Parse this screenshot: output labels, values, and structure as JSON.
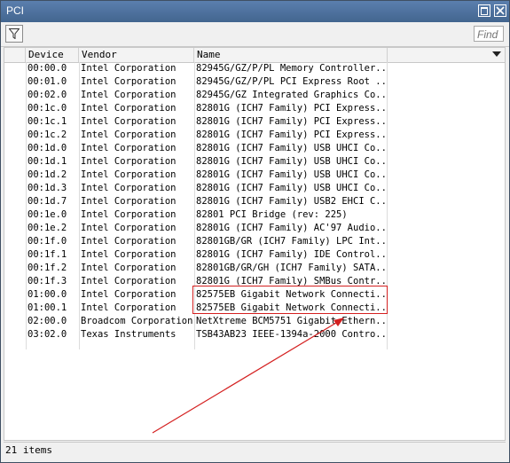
{
  "window": {
    "title": "PCI"
  },
  "toolbar": {
    "find_placeholder": "Find"
  },
  "table": {
    "columns": [
      "Device",
      "Vendor",
      "Name"
    ],
    "rows": [
      {
        "device": "00:00.0",
        "vendor": "Intel Corporation",
        "name": "82945G/GZ/P/PL Memory Controller..."
      },
      {
        "device": "00:01.0",
        "vendor": "Intel Corporation",
        "name": "82945G/GZ/P/PL PCI Express Root ..."
      },
      {
        "device": "00:02.0",
        "vendor": "Intel Corporation",
        "name": "82945G/GZ Integrated Graphics Co..."
      },
      {
        "device": "00:1c.0",
        "vendor": "Intel Corporation",
        "name": "82801G (ICH7 Family) PCI Express..."
      },
      {
        "device": "00:1c.1",
        "vendor": "Intel Corporation",
        "name": "82801G (ICH7 Family) PCI Express..."
      },
      {
        "device": "00:1c.2",
        "vendor": "Intel Corporation",
        "name": "82801G (ICH7 Family) PCI Express..."
      },
      {
        "device": "00:1d.0",
        "vendor": "Intel Corporation",
        "name": "82801G (ICH7 Family) USB UHCI Co..."
      },
      {
        "device": "00:1d.1",
        "vendor": "Intel Corporation",
        "name": "82801G (ICH7 Family) USB UHCI Co..."
      },
      {
        "device": "00:1d.2",
        "vendor": "Intel Corporation",
        "name": "82801G (ICH7 Family) USB UHCI Co..."
      },
      {
        "device": "00:1d.3",
        "vendor": "Intel Corporation",
        "name": "82801G (ICH7 Family) USB UHCI Co..."
      },
      {
        "device": "00:1d.7",
        "vendor": "Intel Corporation",
        "name": "82801G (ICH7 Family) USB2 EHCI C..."
      },
      {
        "device": "00:1e.0",
        "vendor": "Intel Corporation",
        "name": "82801 PCI Bridge (rev: 225)"
      },
      {
        "device": "00:1e.2",
        "vendor": "Intel Corporation",
        "name": "82801G (ICH7 Family) AC'97 Audio..."
      },
      {
        "device": "00:1f.0",
        "vendor": "Intel Corporation",
        "name": "82801GB/GR (ICH7 Family) LPC Int..."
      },
      {
        "device": "00:1f.1",
        "vendor": "Intel Corporation",
        "name": "82801G (ICH7 Family) IDE Control..."
      },
      {
        "device": "00:1f.2",
        "vendor": "Intel Corporation",
        "name": "82801GB/GR/GH (ICH7 Family) SATA..."
      },
      {
        "device": "00:1f.3",
        "vendor": "Intel Corporation",
        "name": "82801G (ICH7 Family) SMBus Contr..."
      },
      {
        "device": "01:00.0",
        "vendor": "Intel Corporation",
        "name": "82575EB Gigabit Network Connecti..."
      },
      {
        "device": "01:00.1",
        "vendor": "Intel Corporation",
        "name": "82575EB Gigabit Network Connecti..."
      },
      {
        "device": "02:00.0",
        "vendor": "Broadcom Corporation",
        "name": "NetXtreme BCM5751 Gigabit Ethern..."
      },
      {
        "device": "03:02.0",
        "vendor": "Texas Instruments",
        "name": "TSB43AB23 IEEE-1394a-2000 Contro..."
      }
    ]
  },
  "status": {
    "items_text": "21 items"
  },
  "colors": {
    "title_bar": "#4e719e",
    "annotation": "#d42020"
  }
}
